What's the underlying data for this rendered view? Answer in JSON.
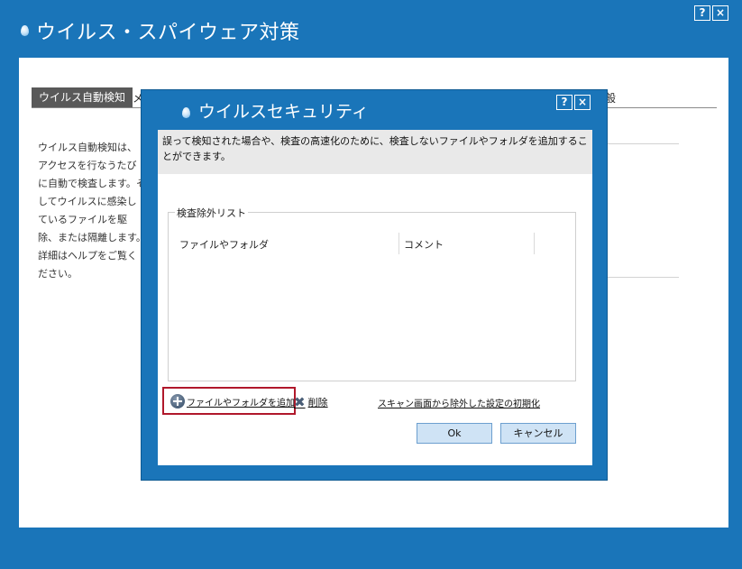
{
  "outer_window": {
    "title": "ウイルス・スパイウェア対策",
    "help_label": "?",
    "close_label": "×",
    "tabs": [
      "ウイルス自動検知",
      "メ",
      "般"
    ],
    "description": "ウイルス自動検知は、アクセスを行なうたびに自動で検査します。そしてウイルスに感染しているファイルを駆除、または隔離します。詳細はヘルプをご覧ください。"
  },
  "dialog": {
    "title": "ウイルスセキュリティ",
    "help_label": "?",
    "close_label": "×",
    "info_text": "誤って検知された場合や、検査の高速化のために、検査しないファイルやフォルダを追加することができます。",
    "group_label": "検査除外リスト",
    "columns": [
      "ファイルやフォルダ",
      "コメント"
    ],
    "add_label": "ファイルやフォルダを追加",
    "delete_label": "削除",
    "reset_label": "スキャン画面から除外した設定の初期化",
    "ok_label": "Ok",
    "cancel_label": "キャンセル"
  },
  "colors": {
    "frame_blue": "#1a75b9",
    "highlight_red": "#b0182b",
    "button_fill": "#cfe3f5"
  }
}
